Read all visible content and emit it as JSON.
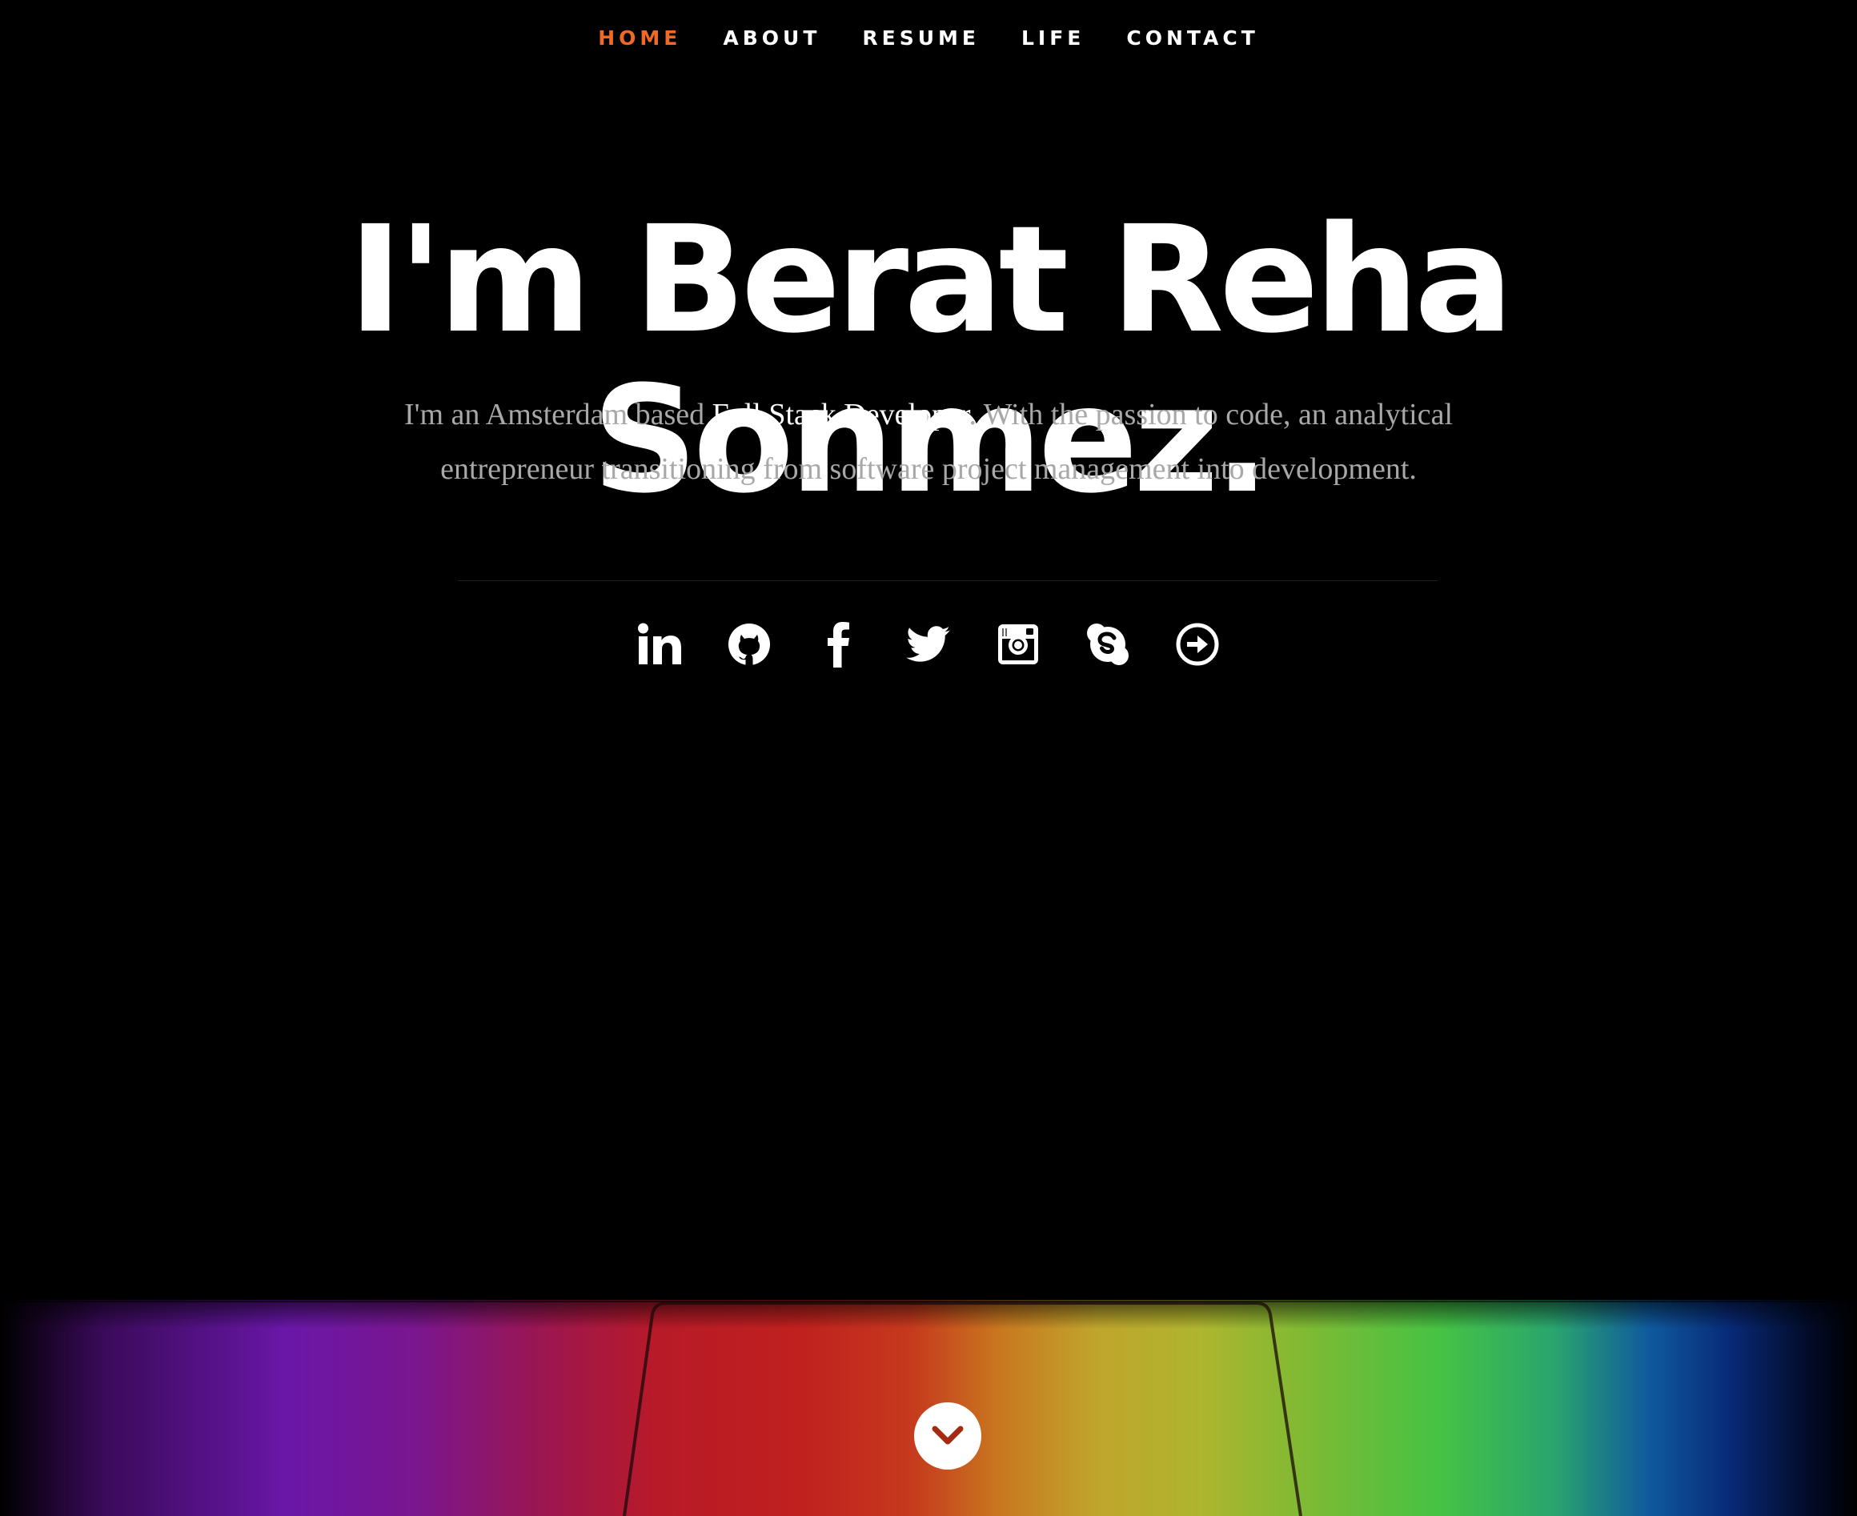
{
  "nav": {
    "items": [
      {
        "label": "HOME",
        "active": true
      },
      {
        "label": "ABOUT",
        "active": false
      },
      {
        "label": "RESUME",
        "active": false
      },
      {
        "label": "LIFE",
        "active": false
      },
      {
        "label": "CONTACT",
        "active": false
      }
    ],
    "active_color": "#f06a25"
  },
  "hero": {
    "title": "I'm Berat Reha Sonmez.",
    "intro_before": "I'm an Amsterdam based ",
    "intro_highlight": "Full Stack Developer",
    "intro_after": ". With the passion to code, an analytical entrepreneur transitioning from software project management into development."
  },
  "social": [
    {
      "icon": "linkedin-icon"
    },
    {
      "icon": "github-icon"
    },
    {
      "icon": "facebook-icon"
    },
    {
      "icon": "twitter-icon"
    },
    {
      "icon": "instagram-icon"
    },
    {
      "icon": "skype-icon"
    },
    {
      "icon": "arrow-right-circle-icon"
    }
  ],
  "scroll_button": {
    "icon": "chevron-down-icon"
  },
  "colors": {
    "background": "#000000",
    "text": "#ffffff",
    "muted_text": "#a8a8a8",
    "accent": "#f06a25"
  }
}
